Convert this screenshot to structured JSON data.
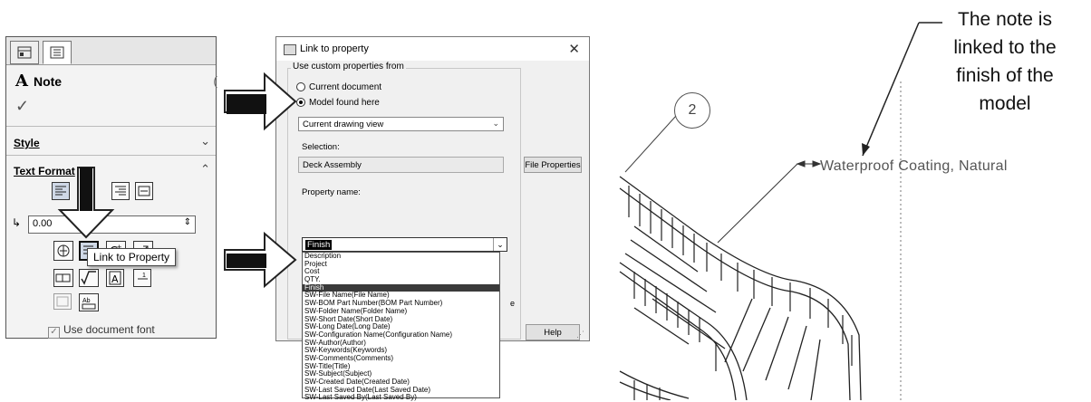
{
  "panel": {
    "title": "Note",
    "style_label": "Style",
    "text_format_label": "Text Format",
    "angle_value": "0.00",
    "use_document_font": "Use document font",
    "tooltip": "Link to Property"
  },
  "dialog": {
    "title": "Link to property",
    "group_label": "Use custom properties from",
    "radio_current": "Current document",
    "radio_model": "Model found here",
    "view_combo": "Current drawing view",
    "selection_label": "Selection:",
    "selection_value": "Deck Assembly",
    "file_properties_btn": "File Properties",
    "property_name_label": "Property name:",
    "property_value": "Finish",
    "help_btn": "Help",
    "tail_char": "e",
    "list": [
      "Description",
      "Project",
      "Cost",
      "QTY.",
      "Finish",
      "SW-File Name(File Name)",
      "SW-BOM Part Number(BOM Part Number)",
      "SW-Folder Name(Folder Name)",
      "SW-Short Date(Short Date)",
      "SW-Long Date(Long Date)",
      "SW-Configuration Name(Configuration Name)",
      "SW-Author(Author)",
      "SW-Keywords(Keywords)",
      "SW-Comments(Comments)",
      "SW-Title(Title)",
      "SW-Subject(Subject)",
      "SW-Created Date(Created Date)",
      "SW-Last Saved Date(Last Saved Date)",
      "SW-Last Saved By(Last Saved By)"
    ]
  },
  "drawing": {
    "balloon": "2",
    "note": "Waterproof Coating, Natural"
  },
  "caption": {
    "line1": "The note is",
    "line2": "linked to the",
    "line3": "finish of the",
    "line4": "model"
  }
}
